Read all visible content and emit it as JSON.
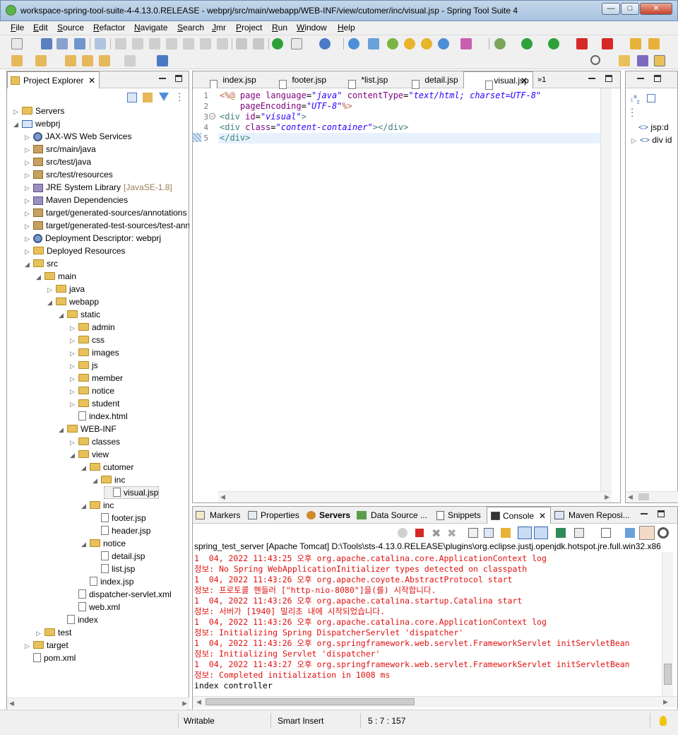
{
  "window": {
    "title": "workspace-spring-tool-suite-4-4.13.0.RELEASE - webprj/src/main/webapp/WEB-INF/view/cutomer/inc/visual.jsp - Spring Tool Suite 4"
  },
  "menu": [
    "File",
    "Edit",
    "Source",
    "Refactor",
    "Navigate",
    "Search",
    "Jmr",
    "Project",
    "Run",
    "Window",
    "Help"
  ],
  "explorer": {
    "title": "Project Explorer",
    "items": [
      {
        "label": "Servers",
        "depth": 0,
        "type": "folder",
        "exp": "c"
      },
      {
        "label": "webprj",
        "depth": 0,
        "type": "project",
        "exp": "o"
      },
      {
        "label": "JAX-WS Web Services",
        "depth": 1,
        "type": "gear",
        "exp": "c"
      },
      {
        "label": "src/main/java",
        "depth": 1,
        "type": "pkg",
        "exp": "c"
      },
      {
        "label": "src/test/java",
        "depth": 1,
        "type": "pkg",
        "exp": "c"
      },
      {
        "label": "src/test/resources",
        "depth": 1,
        "type": "pkg",
        "exp": "c"
      },
      {
        "label": "JRE System Library",
        "suffix": "[JavaSE-1.8]",
        "depth": 1,
        "type": "jar",
        "exp": "c"
      },
      {
        "label": "Maven Dependencies",
        "depth": 1,
        "type": "jar",
        "exp": "c"
      },
      {
        "label": "target/generated-sources/annotations",
        "depth": 1,
        "type": "pkg",
        "exp": "c"
      },
      {
        "label": "target/generated-test-sources/test-anno",
        "depth": 1,
        "type": "pkg",
        "exp": "c"
      },
      {
        "label": "Deployment Descriptor: webprj",
        "depth": 1,
        "type": "gear",
        "exp": "c"
      },
      {
        "label": "Deployed Resources",
        "depth": 1,
        "type": "folder",
        "exp": "c"
      },
      {
        "label": "src",
        "depth": 1,
        "type": "folder",
        "exp": "o"
      },
      {
        "label": "main",
        "depth": 2,
        "type": "folder",
        "exp": "o"
      },
      {
        "label": "java",
        "depth": 3,
        "type": "folder",
        "exp": "c"
      },
      {
        "label": "webapp",
        "depth": 3,
        "type": "folder",
        "exp": "o"
      },
      {
        "label": "static",
        "depth": 4,
        "type": "folder",
        "exp": "o"
      },
      {
        "label": "admin",
        "depth": 5,
        "type": "folder",
        "exp": "c"
      },
      {
        "label": "css",
        "depth": 5,
        "type": "folder",
        "exp": "c"
      },
      {
        "label": "images",
        "depth": 5,
        "type": "folder",
        "exp": "c"
      },
      {
        "label": "js",
        "depth": 5,
        "type": "folder",
        "exp": "c"
      },
      {
        "label": "member",
        "depth": 5,
        "type": "folder",
        "exp": "c"
      },
      {
        "label": "notice",
        "depth": 5,
        "type": "folder",
        "exp": "c"
      },
      {
        "label": "student",
        "depth": 5,
        "type": "folder",
        "exp": "c"
      },
      {
        "label": "index.html",
        "depth": 5,
        "type": "file",
        "exp": ""
      },
      {
        "label": "WEB-INF",
        "depth": 4,
        "type": "folder",
        "exp": "o"
      },
      {
        "label": "classes",
        "depth": 5,
        "type": "folder",
        "exp": "c"
      },
      {
        "label": "view",
        "depth": 5,
        "type": "folder",
        "exp": "o"
      },
      {
        "label": "cutomer",
        "depth": 6,
        "type": "folder",
        "exp": "o"
      },
      {
        "label": "inc",
        "depth": 7,
        "type": "folder",
        "exp": "o"
      },
      {
        "label": "visual.jsp",
        "depth": 8,
        "type": "file",
        "exp": "",
        "selected": true
      },
      {
        "label": "inc",
        "depth": 6,
        "type": "folder",
        "exp": "o"
      },
      {
        "label": "footer.jsp",
        "depth": 7,
        "type": "file",
        "exp": ""
      },
      {
        "label": "header.jsp",
        "depth": 7,
        "type": "file",
        "exp": ""
      },
      {
        "label": "notice",
        "depth": 6,
        "type": "folder",
        "exp": "o"
      },
      {
        "label": "detail.jsp",
        "depth": 7,
        "type": "file",
        "exp": ""
      },
      {
        "label": "list.jsp",
        "depth": 7,
        "type": "file",
        "exp": ""
      },
      {
        "label": "index.jsp",
        "depth": 6,
        "type": "file",
        "exp": ""
      },
      {
        "label": "dispatcher-servlet.xml",
        "depth": 5,
        "type": "file",
        "exp": ""
      },
      {
        "label": "web.xml",
        "depth": 5,
        "type": "file",
        "exp": ""
      },
      {
        "label": "index",
        "depth": 4,
        "type": "file",
        "exp": ""
      },
      {
        "label": "test",
        "depth": 2,
        "type": "folder",
        "exp": "c"
      },
      {
        "label": "target",
        "depth": 1,
        "type": "folder",
        "exp": "c"
      },
      {
        "label": "pom.xml",
        "depth": 1,
        "type": "file",
        "exp": ""
      }
    ]
  },
  "editor": {
    "tabs": [
      "index.jsp",
      "footer.jsp",
      "*list.jsp",
      "detail.jsp",
      "visual.jsp"
    ],
    "overflow": "»1",
    "line_numbers": [
      "1",
      "2",
      "3",
      "4",
      "5"
    ]
  },
  "outline": {
    "items": [
      "jsp:d",
      "div id"
    ]
  },
  "bottom": {
    "tabs": [
      "Markers",
      "Properties",
      "Servers",
      "Data Source ...",
      "Snippets",
      "Console",
      "Maven Reposi..."
    ],
    "console_header": "spring_test_server [Apache Tomcat] D:\\Tools\\sts-4.13.0.RELEASE\\plugins\\org.eclipse.justj.openjdk.hotspot.jre.full.win32.x86",
    "lines": [
      {
        "text": "1  04, 2022 11:43:25 오후 org.apache.catalina.core.ApplicationContext log",
        "color": "red"
      },
      {
        "text": "정보: No Spring WebApplicationInitializer types detected on classpath",
        "color": "red"
      },
      {
        "text": "1  04, 2022 11:43:26 오후 org.apache.coyote.AbstractProtocol start",
        "color": "red"
      },
      {
        "text": "정보: 프로토콜 핸들러 [\"http-nio-8080\"]을(를) 시작합니다.",
        "color": "red"
      },
      {
        "text": "1  04, 2022 11:43:26 오후 org.apache.catalina.startup.Catalina start",
        "color": "red"
      },
      {
        "text": "정보: 서버가 [1940] 밀리초 내에 시작되었습니다.",
        "color": "red"
      },
      {
        "text": "1  04, 2022 11:43:26 오후 org.apache.catalina.core.ApplicationContext log",
        "color": "red"
      },
      {
        "text": "정보: Initializing Spring DispatcherServlet 'dispatcher'",
        "color": "red"
      },
      {
        "text": "1  04, 2022 11:43:26 오후 org.springframework.web.servlet.FrameworkServlet initServletBean",
        "color": "red"
      },
      {
        "text": "정보: Initializing Servlet 'dispatcher'",
        "color": "red"
      },
      {
        "text": "1  04, 2022 11:43:27 오후 org.springframework.web.servlet.FrameworkServlet initServletBean",
        "color": "red"
      },
      {
        "text": "정보: Completed initialization in 1008 ms",
        "color": "red"
      },
      {
        "text": "index controller",
        "color": "black"
      }
    ]
  },
  "status": {
    "writable": "Writable",
    "insert": "Smart Insert",
    "position": "5 : 7 : 157"
  }
}
